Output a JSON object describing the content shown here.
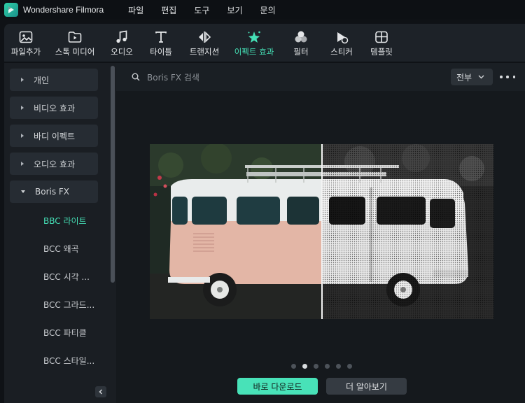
{
  "app": {
    "title": "Wondershare Filmora"
  },
  "menu": [
    "파일",
    "편집",
    "도구",
    "보기",
    "문의"
  ],
  "toolbar": {
    "items": [
      {
        "label": "파일추가",
        "icon": "media-icon"
      },
      {
        "label": "스톡 미디어",
        "icon": "stock-media-icon"
      },
      {
        "label": "오디오",
        "icon": "music-icon"
      },
      {
        "label": "타이틀",
        "icon": "text-icon"
      },
      {
        "label": "트랜지션",
        "icon": "transition-icon"
      },
      {
        "label": "이펙트 효과",
        "icon": "effects-icon",
        "active": true
      },
      {
        "label": "필터",
        "icon": "filter-icon"
      },
      {
        "label": "스티커",
        "icon": "sticker-icon"
      },
      {
        "label": "템플릿",
        "icon": "template-icon"
      }
    ]
  },
  "sidebar": {
    "categories": [
      "개인",
      "비디오 효과",
      "바디 이펙트",
      "오디오 효과",
      "Boris FX"
    ],
    "subitems": [
      "BBC 라이트",
      "BCC 왜곡",
      "BCC 시각 ...",
      "BCC 그라드...",
      "BCC 파티클",
      "BCC 스타일..."
    ],
    "active_subitem": "BBC 라이트"
  },
  "search": {
    "placeholder": "Boris FX 검색"
  },
  "filter": {
    "selected": "전부"
  },
  "carousel": {
    "count": 6,
    "active_index": 1
  },
  "buttons": {
    "download": "바로 다운로드",
    "learn_more": "더 알아보기"
  },
  "colors": {
    "accent": "#45e0b6",
    "button_primary": "#48e2b8"
  }
}
